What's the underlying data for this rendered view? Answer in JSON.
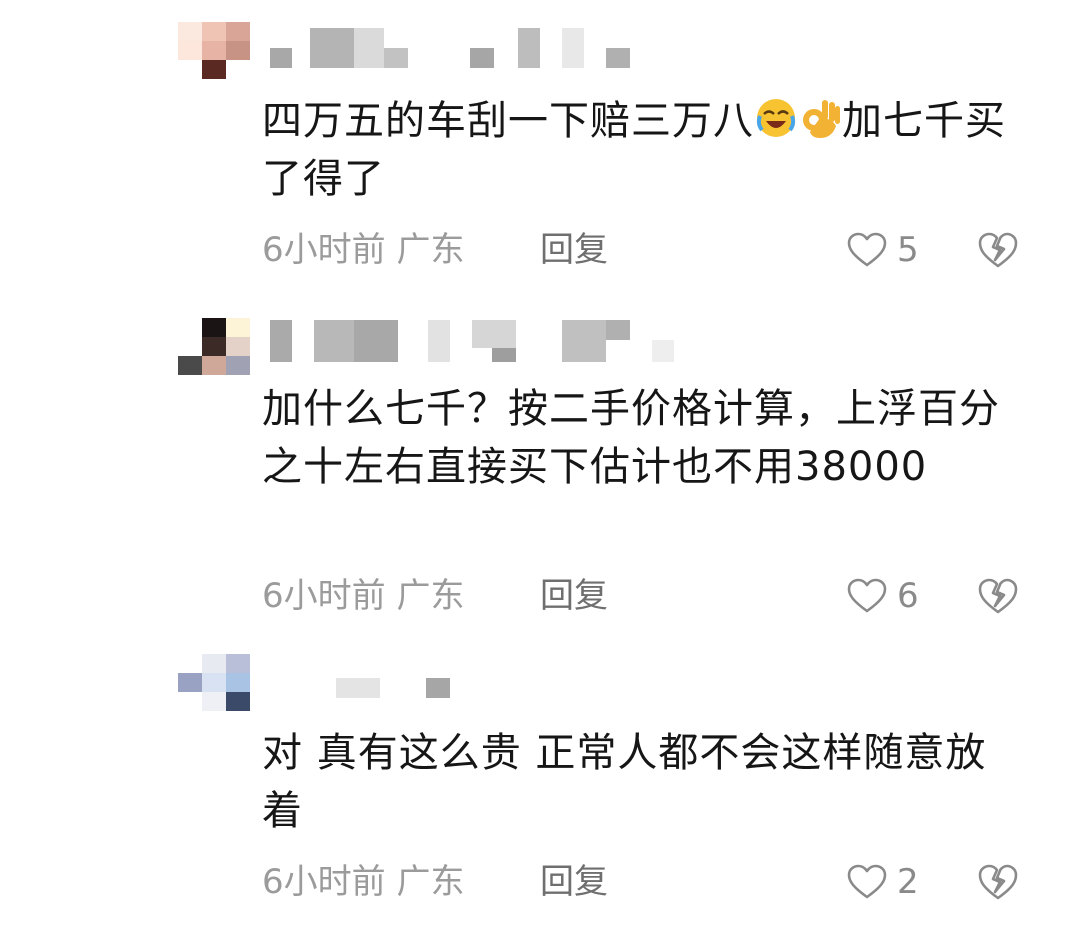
{
  "comments": [
    {
      "text_before": "四万五的车刮一下赔三万八",
      "emojis": [
        "crying-laughing-emoji",
        "ok-hand-emoji"
      ],
      "text_after": "加七千买了得了",
      "time": "6小时前",
      "location": "广东",
      "reply_label": "回复",
      "likes": "5"
    },
    {
      "text": "加什么七千？按二手价格计算，上浮百分之十左右直接买下估计也不用38000",
      "time": "6小时前",
      "location": "广东",
      "reply_label": "回复",
      "likes": "6"
    },
    {
      "text": "对 真有这么贵 正常人都不会这样随意放着",
      "time": "6小时前",
      "location": "广东",
      "reply_label": "回复",
      "likes": "2"
    }
  ],
  "colors": {
    "text": "#161616",
    "meta": "#9b9b9b",
    "reply": "#6f6f6f",
    "icon": "#8a8a8a"
  },
  "icons": [
    "heart-outline-icon",
    "broken-heart-icon"
  ]
}
